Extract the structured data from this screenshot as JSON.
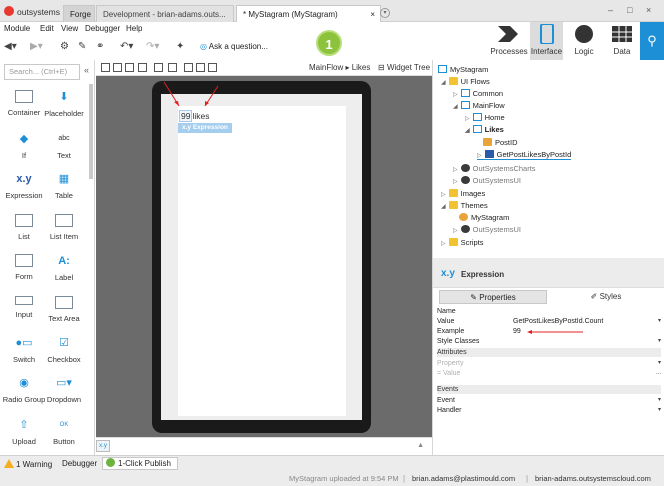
{
  "titlebar": {
    "app_name": "outsystems",
    "tabs": [
      "Forge",
      "Development - brian-adams.outs...",
      "* MyStagram (MyStagram)"
    ],
    "close_tab": "×",
    "window_minimize": "–",
    "window_restore": "□",
    "window_close": "×"
  },
  "menu": {
    "items": [
      "Module",
      "Edit",
      "View",
      "Debugger",
      "Help"
    ]
  },
  "toolbar": {
    "ask_question": "Ask a question...",
    "publish_number": "1"
  },
  "nav": {
    "processes": "Processes",
    "interface": "Interface",
    "logic": "Logic",
    "data": "Data",
    "accent_color": "#1d8fd6"
  },
  "toolbox": {
    "search_placeholder": "Search... (Ctrl+E)",
    "collapse": "«",
    "widgets": [
      {
        "label": "Container",
        "icon": "container-icon"
      },
      {
        "label": "Placeholder",
        "icon": "placeholder-icon"
      },
      {
        "label": "If",
        "icon": "if-icon"
      },
      {
        "label": "Text",
        "icon": "text-icon",
        "glyph": "abc"
      },
      {
        "label": "Expression",
        "icon": "expression-icon",
        "glyph": "x.y"
      },
      {
        "label": "Table",
        "icon": "table-icon"
      },
      {
        "label": "List",
        "icon": "list-icon"
      },
      {
        "label": "List Item",
        "icon": "list-item-icon"
      },
      {
        "label": "Form",
        "icon": "form-icon"
      },
      {
        "label": "Label",
        "icon": "label-icon",
        "glyph": "A:"
      },
      {
        "label": "Input",
        "icon": "input-icon"
      },
      {
        "label": "Text Area",
        "icon": "text-area-icon"
      },
      {
        "label": "Switch",
        "icon": "switch-icon"
      },
      {
        "label": "Checkbox",
        "icon": "checkbox-icon"
      },
      {
        "label": "Radio Group",
        "icon": "radio-group-icon"
      },
      {
        "label": "Dropdown",
        "icon": "dropdown-icon"
      },
      {
        "label": "Upload",
        "icon": "upload-icon"
      },
      {
        "label": "Button",
        "icon": "button-icon",
        "glyph": "OK"
      }
    ]
  },
  "canvas": {
    "breadcrumb": "MainFlow ▸ Likes",
    "widget_tree": "Widget Tree",
    "likes_number": "99",
    "likes_word": "likes",
    "expression_tag": "x.y  Expression",
    "footer_chip": "x.y"
  },
  "tree": {
    "root": "MyStagram",
    "ui_flows": "UI Flows",
    "common": "Common",
    "mainflow": "MainFlow",
    "home": "Home",
    "likes": "Likes",
    "postid": "PostID",
    "getpost": "GetPostLikesByPostId",
    "os_charts": "OutSystemsCharts",
    "os_ui": "OutSystemsUI",
    "images": "Images",
    "themes": "Themes",
    "theme_mystagram": "MyStagram",
    "theme_osui": "OutSystemsUI",
    "scripts": "Scripts"
  },
  "properties": {
    "header_icon": "x.y",
    "header_title": "Expression",
    "tab_properties": "Properties",
    "tab_styles": "Styles",
    "rows": {
      "name_key": "Name",
      "value_key": "Value",
      "value_val": "GetPostLikesByPostId.Count",
      "example_key": "Example",
      "example_val": "99",
      "style_key": "Style Classes",
      "attributes": "Attributes",
      "property_key": "Property",
      "value2_key": "= Value",
      "value2_val": "...",
      "events": "Events",
      "event_key": "Event",
      "handler_key": "Handler"
    }
  },
  "status": {
    "warning": "1 Warning",
    "debugger": "Debugger",
    "publish": "1-Click Publish",
    "upload": "MyStagram uploaded at 9:54 PM",
    "user": "brian.adams@plastimould.com",
    "server": "brian-adams.outsystemscloud.com",
    "separator": "|"
  }
}
